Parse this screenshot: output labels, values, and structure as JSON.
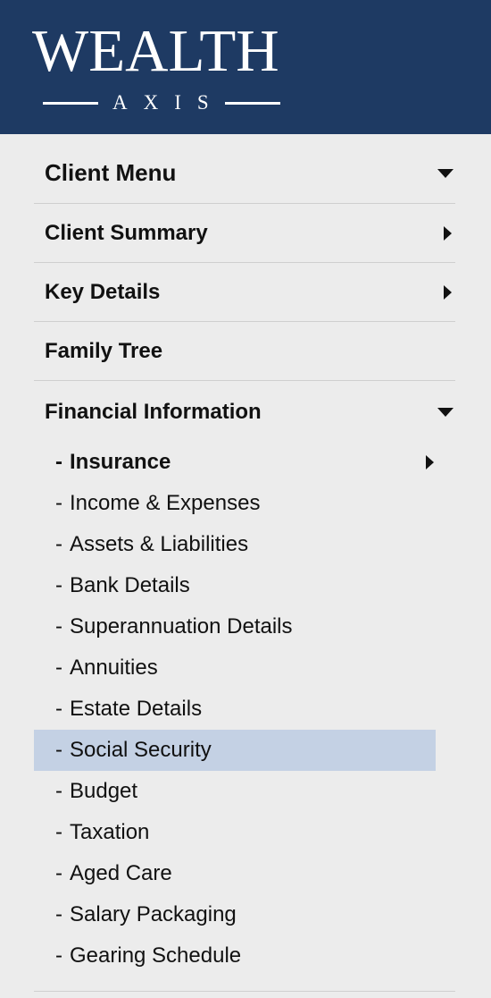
{
  "logo": {
    "top_text": "WEALTH",
    "bottom_text": "AXIS"
  },
  "menu": {
    "client_menu": {
      "label": "Client Menu",
      "indicator": "chevron-down-icon"
    },
    "items": [
      {
        "label": "Client Summary",
        "indicator": "chevron-right-icon"
      },
      {
        "label": "Key Details",
        "indicator": "chevron-right-icon"
      },
      {
        "label": "Family Tree",
        "indicator": ""
      }
    ],
    "financial": {
      "label": "Financial Information",
      "indicator": "chevron-down-icon",
      "subitems": [
        {
          "label": "Insurance",
          "bold": true,
          "indicator": "chevron-right-icon"
        },
        {
          "label": "Income & Expenses"
        },
        {
          "label": "Assets & Liabilities"
        },
        {
          "label": "Bank Details"
        },
        {
          "label": "Superannuation Details"
        },
        {
          "label": "Annuities"
        },
        {
          "label": "Estate Details"
        },
        {
          "label": "Social Security",
          "selected": true
        },
        {
          "label": "Budget"
        },
        {
          "label": "Taxation"
        },
        {
          "label": "Aged Care"
        },
        {
          "label": "Salary Packaging"
        },
        {
          "label": "Gearing Schedule"
        }
      ]
    }
  },
  "colors": {
    "header_bg": "#1e3a63",
    "selected_bg": "#c4d1e4",
    "page_bg": "#ececec"
  }
}
